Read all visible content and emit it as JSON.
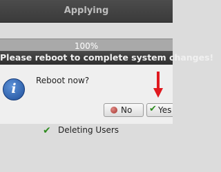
{
  "window": {
    "title": "Applying"
  },
  "progress": {
    "value": 100,
    "label": "100%"
  },
  "dialog": {
    "title": "Please reboot to complete system changes!",
    "icon": "info-icon",
    "question": "Reboot now?",
    "buttons": {
      "no": {
        "label": "No",
        "icon": "stop-icon"
      },
      "yes": {
        "label": "Yes",
        "icon": "check-icon"
      }
    }
  },
  "status": {
    "icon": "check-icon",
    "text": "Deleting Users"
  },
  "colors": {
    "arrow": "#e0191f",
    "check": "#2e8b1f",
    "info": "#2a63b8"
  }
}
